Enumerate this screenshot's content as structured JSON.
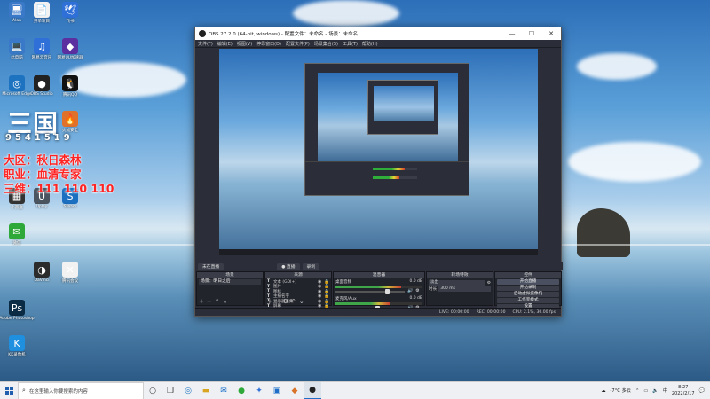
{
  "desktop": {
    "icons": [
      {
        "label": "Alan",
        "glyph": "🖥",
        "color": "#3a78c8"
      },
      {
        "label": "开单项目",
        "glyph": "📄",
        "color": "#f2f2f2"
      },
      {
        "label": "飞书",
        "glyph": "🕊",
        "color": "#2f6fd8"
      },
      {
        "label": "此电脑",
        "glyph": "💻",
        "color": "#3a78c8"
      },
      {
        "label": "网易云音乐",
        "glyph": "♫",
        "color": "#2f6fd8"
      },
      {
        "label": "网易UU加速器",
        "glyph": "◆",
        "color": "#5b2fa0"
      },
      {
        "label": "Microsoft Edge",
        "glyph": "◎",
        "color": "#1e73c0"
      },
      {
        "label": "OBS Studio",
        "glyph": "●",
        "color": "#222"
      },
      {
        "label": "腾讯QQ",
        "glyph": "🐧",
        "color": "#111"
      },
      {
        "label": "火绒安全",
        "glyph": "🔥",
        "color": "#e0712a"
      },
      {
        "label": "小黑盒",
        "glyph": "▦",
        "color": "#333"
      },
      {
        "label": "Uplay",
        "glyph": "U",
        "color": "#4a5560"
      },
      {
        "label": "Steam",
        "glyph": "S",
        "color": "#1b6fc0"
      },
      {
        "label": "微信",
        "glyph": "✉",
        "color": "#2fa83a"
      },
      {
        "label": "Adobe Photoshop",
        "glyph": "Ps",
        "color": "#0b2a44"
      },
      {
        "label": "KK录像机",
        "glyph": "K",
        "color": "#1f8fe0"
      },
      {
        "label": "DaVinci",
        "glyph": "◑",
        "color": "#2b2b2b"
      },
      {
        "label": "腾讯会议",
        "glyph": "✕",
        "color": "#f2f2f2"
      }
    ],
    "promo": {
      "title": "三国",
      "number": "9541519",
      "lines": [
        "大区：秋日森林",
        "职业：血清专家",
        "三维：111 110 110"
      ]
    }
  },
  "obs": {
    "title": "OBS 27.2.0 (64-bit, windows) - 配置文件：未命名 - 场景：未命名",
    "menu": [
      "文件(F)",
      "编辑(E)",
      "视图(V)",
      "停靠窗口(D)",
      "配置文件(P)",
      "场景集合(S)",
      "工具(T)",
      "帮助(H)"
    ],
    "tabs": [
      "未在直播",
      "● 直播",
      "录制"
    ],
    "docks": {
      "scenes_title": "场景",
      "sources_title": "来源",
      "mixer_title": "混音器",
      "transitions_title": "转场特效",
      "controls_title": "控件"
    },
    "scenes": [
      "场景：明日之后"
    ],
    "sources": [
      {
        "name": "文本 (GDI+)"
      },
      {
        "name": "图片"
      },
      {
        "name": "图标"
      },
      {
        "name": "主播名字"
      },
      {
        "name": "显示器采集"
      },
      {
        "name": "屏幕"
      }
    ],
    "mixer": [
      {
        "name": "桌面音频",
        "db": "0.0 dB",
        "level": 0.75
      },
      {
        "name": "麦克风/Aux",
        "db": "0.0 dB",
        "level": 0.62
      }
    ],
    "transition": {
      "type": "淡出",
      "duration_label": "时长",
      "duration": "300 ms"
    },
    "controls": [
      "开始直播",
      "开始录制",
      "启动虚拟摄像机",
      "工作室模式",
      "设置",
      "退出"
    ],
    "status": {
      "live": "LIVE: 00:00:00",
      "rec": "REC: 00:00:00",
      "cpu": "CPU: 2.1%, 30.00 fps"
    }
  },
  "taskbar": {
    "search_placeholder": "在这里输入你要搜索的内容",
    "weather": "-7°C 多云",
    "time": "8:27",
    "date": "2022/2/17",
    "lang": "中"
  }
}
